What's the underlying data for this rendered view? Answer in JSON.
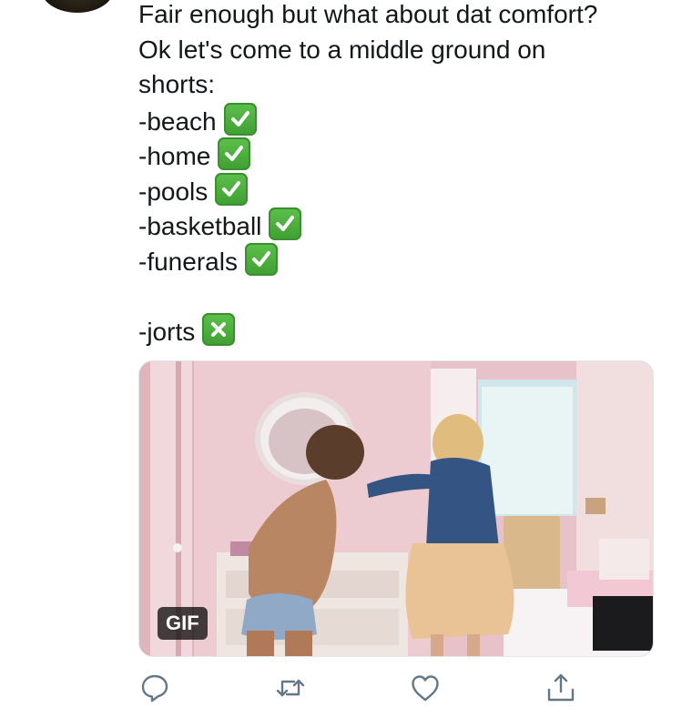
{
  "tweet": {
    "lines": [
      "Fair enough but what about dat comfort?",
      "Ok let's come to a middle ground on",
      "shorts:",
      "-beach",
      "-home",
      "-pools",
      "-basketball",
      "-funerals",
      "-jorts"
    ],
    "emojis": {
      "approved": "white-heavy-check-mark",
      "rejected": "negative-squared-cross-mark"
    }
  },
  "media": {
    "badge": "GIF",
    "scene": "pink bedroom scene"
  },
  "actions": {
    "icons": [
      "reply-icon",
      "retweet-icon",
      "like-icon",
      "share-icon"
    ],
    "color": "#657786"
  },
  "colors": {
    "text": "#14171a",
    "emoji_green": "#4fae3f",
    "badge_bg": "#000000"
  }
}
